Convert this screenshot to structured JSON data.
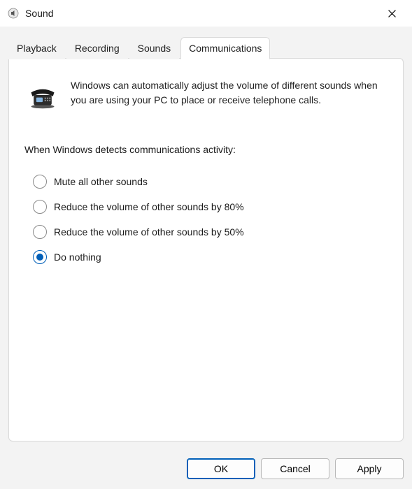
{
  "window": {
    "title": "Sound"
  },
  "tabs": {
    "playback": "Playback",
    "recording": "Recording",
    "sounds": "Sounds",
    "communications": "Communications",
    "active": "communications"
  },
  "content": {
    "description": "Windows can automatically adjust the volume of different sounds when you are using your PC to place or receive telephone calls.",
    "section_label": "When Windows detects communications activity:"
  },
  "options": {
    "mute": "Mute all other sounds",
    "reduce80": "Reduce the volume of other sounds by 80%",
    "reduce50": "Reduce the volume of other sounds by 50%",
    "donothing": "Do nothing",
    "selected": "donothing"
  },
  "buttons": {
    "ok": "OK",
    "cancel": "Cancel",
    "apply": "Apply"
  }
}
